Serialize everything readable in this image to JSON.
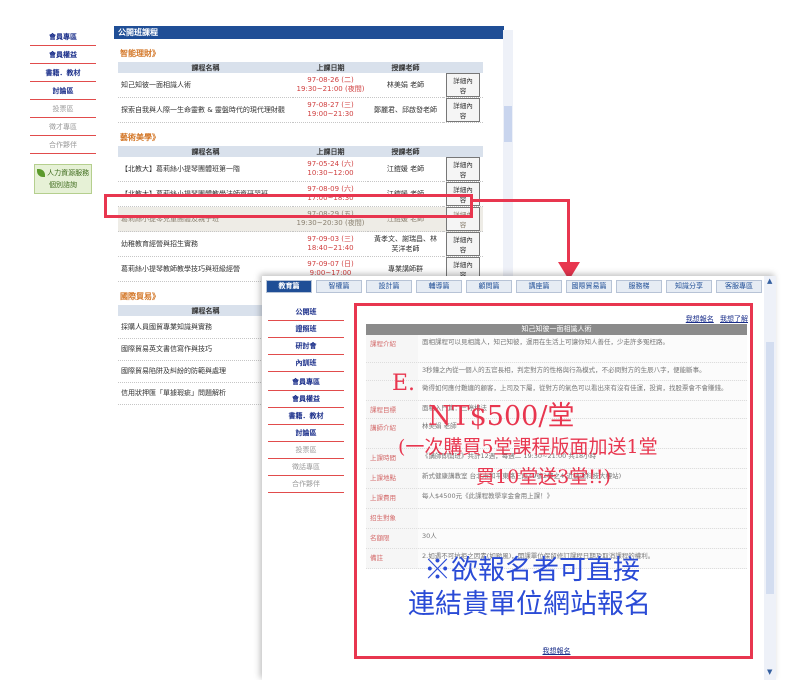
{
  "back": {
    "left_nav": [
      {
        "label": "會員專區",
        "muted": false
      },
      {
        "label": "會員權益",
        "muted": false
      },
      {
        "label": "書籍．教材",
        "muted": false
      },
      {
        "label": "討論區",
        "muted": false
      },
      {
        "label": "投票區",
        "muted": true
      },
      {
        "label": "徵才專區",
        "muted": true
      },
      {
        "label": "合作夥伴",
        "muted": true
      }
    ],
    "hr_logo_line1": "人力資源服務",
    "hr_logo_line2": "個別諮詢",
    "topbar": "公開班課程",
    "sections": [
      {
        "heading": "智能理財》",
        "rows": [
          {
            "name": "知己知彼一面相識人術",
            "date1": "97-08-26 (二)",
            "date2": "19:30~21:00 (夜間)",
            "teacher": "林美娟 老師",
            "btn": "詳細內容",
            "hl": false
          },
          {
            "name": "探索自我與人際一生命靈數 & 靈盤時代的現代理財觀",
            "date1": "97-08-27 (三)",
            "date2": "19:00~21:30",
            "teacher": "鄭麗君、邱啟發老師",
            "btn": "詳細內容",
            "hl": false
          }
        ]
      },
      {
        "heading": "藝術美學》",
        "rows": [
          {
            "name": "【北教大】葛莉絲小提琴團體班第一階",
            "date1": "97-05-24 (六)",
            "date2": "10:30~12:00",
            "teacher": "江鎧媛 老師",
            "btn": "詳細內容",
            "hl": false
          },
          {
            "name": "【北教大】葛莉絲小提琴團體教學法師資研習班",
            "date1": "97-08-09 (六)",
            "date2": "17:00~18:30",
            "teacher": "江鎧媛 老師",
            "btn": "詳細內容",
            "hl": false
          },
          {
            "name": "葛莉絲小提琴兒童團體及親子班",
            "date1": "97-08-29 (五)",
            "date2": "19:30~20:30 (夜間)",
            "teacher": "江鎧媛 老師",
            "btn": "詳細內容",
            "hl": true
          },
          {
            "name": "幼稚教育經營與招生實務",
            "date1": "97-09-03 (三)",
            "date2": "18:40~21:40",
            "teacher": "黃孝文、謝瑞昌、林芙洋老師",
            "btn": "詳細內容",
            "hl": false
          },
          {
            "name": "葛莉絲小提琴教師教學技巧與班級經營",
            "date1": "97-09-07 (日)",
            "date2": "9:00~17:00",
            "teacher": "專業講師群",
            "btn": "詳細內容",
            "hl": false
          }
        ]
      },
      {
        "heading": "國際貿易》",
        "rows": []
      }
    ],
    "th_name": "課程名稱",
    "th_date": "上課日期",
    "th_teacher": "授課老師",
    "trade_rows": [
      "採購人員國貿專業知識與實務",
      "國際貿易英文書信寫作與技巧",
      "國際貿易陷阱及糾紛的防範與處理",
      "信用狀押匯「單據瑕疵」問題解析"
    ]
  },
  "front": {
    "tabs": [
      {
        "label": "教育篇",
        "active": true
      },
      {
        "label": "智權篇",
        "active": false
      },
      {
        "label": "設計篇",
        "active": false
      },
      {
        "label": "輔導篇",
        "active": false
      },
      {
        "label": "顧問篇",
        "active": false
      },
      {
        "label": "講座篇",
        "active": false
      },
      {
        "label": "國際貿易篇",
        "active": false
      },
      {
        "label": "服務梯",
        "active": false
      },
      {
        "label": "知識分享",
        "active": false
      },
      {
        "label": "客服專區",
        "active": false
      }
    ],
    "nav": [
      {
        "label": "公開班",
        "muted": false
      },
      {
        "label": "證照班",
        "muted": false
      },
      {
        "label": "研討會",
        "muted": false
      },
      {
        "label": "內訓班",
        "muted": false
      },
      {
        "label": "會員專區",
        "muted": false
      },
      {
        "label": "會員權益",
        "muted": false
      },
      {
        "label": "書籍．教材",
        "muted": false
      },
      {
        "label": "討論區",
        "muted": false
      },
      {
        "label": "投票區",
        "muted": true
      },
      {
        "label": "徵話專區",
        "muted": true
      },
      {
        "label": "合作夥伴",
        "muted": true
      }
    ],
    "link_signup": "我想報名",
    "link_more": "我想了解",
    "course_title": "知己知彼一面相識人術",
    "details": [
      {
        "label": "課程介紹",
        "text": "面相課程可以見相識人，知己知彼，運用在生活上可讓你知人善任，少走許多冤枉路。"
      },
      {
        "label": "",
        "text": "3秒鐘之內從一個人的五官長相，判定對方的性格與行為模式，不必問對方的生辰八字，便能斷事。"
      },
      {
        "label": "",
        "text": "徵得如何應付難纏的顧客，上司及下屬，從對方的氣色可以看出來有沒有佳運，投資，找股票會不會賺錢。"
      },
      {
        "label": "課程目標",
        "text": "面相入門篇：三停相法"
      },
      {
        "label": "講師介紹",
        "text": "林美娟 老師"
      },
      {
        "label": "上課時間",
        "text": "《講師即開班》共計12週，每週二 19:30~21:00 共18小時"
      },
      {
        "label": "上課地點",
        "text": "新式健康講教室 台北市和平東路三段49號2樓之4(近捷運科技大樓站)"
      },
      {
        "label": "上課費用",
        "text": "每人$4500元《此課程教學享金會用上課！》"
      },
      {
        "label": "招生對象",
        "text": ""
      },
      {
        "label": "名額限",
        "text": "30人"
      },
      {
        "label": "備註",
        "text": "2.如遇不可抗拒之因素(如颱風)，開課單位保留修訂課程日期及取消課程的權利。"
      }
    ],
    "bottom_signup": "我想報名"
  },
  "overlay": {
    "e": "E.",
    "price": "NT$500/堂",
    "line1": "(一次購買5堂課程版面加送1堂",
    "line2": "買10堂送3堂!!)",
    "blue1": "※欲報名者可直接",
    "blue2": "連結貴單位網站報名"
  },
  "colors": {
    "accent": "#e8364f",
    "nav_blue": "#1f4e96",
    "overlay_blue": "#2a4bd6"
  }
}
